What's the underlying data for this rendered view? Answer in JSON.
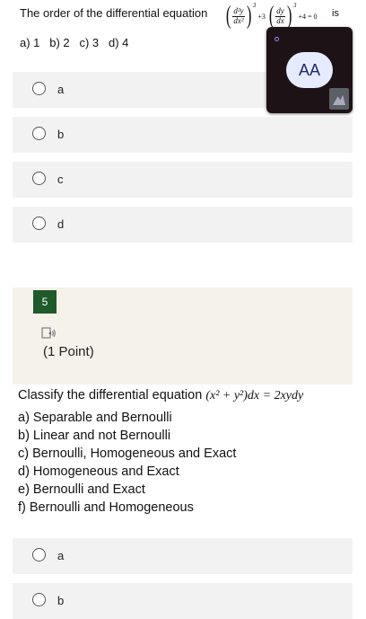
{
  "question1": {
    "text_prefix": "The order of the differential equation",
    "equation": {
      "t1_num": "d²y",
      "t1_den": "dx²",
      "t1_exp": "3",
      "plus1": "+3",
      "t2_num": "dy",
      "t2_den": "dx",
      "t2_exp": "3",
      "plus2": "+4 = 0"
    },
    "suffix": "is",
    "options_line": "a) 1   b) 2   c) 3   d) 4",
    "choices": [
      "a",
      "b",
      "c",
      "d"
    ]
  },
  "popup": {
    "aa_label": "AA"
  },
  "question2": {
    "number": "5",
    "points": "(1 Point)",
    "title_prefix": "Classify the differential equation",
    "equation": "(x² + y²)dx = 2xydy",
    "lines": [
      "a) Separable and Bernoulli",
      "b) Linear and not Bernoulli",
      "c) Bernoulli, Homogeneous and Exact",
      "d) Homogeneous and Exact",
      "e) Bernoulli and Exact",
      "f) Bernoulli and Homogeneous"
    ],
    "choices": [
      "a",
      "b"
    ]
  },
  "icons": {
    "audio": "speaker-icon",
    "font_size": "text-size-icon"
  },
  "colors": {
    "question_badge": "#1f5a2a",
    "section_bg": "#f4f2e9",
    "option_bg": "#f2f2f2",
    "popup_bg": "#1d1216"
  }
}
